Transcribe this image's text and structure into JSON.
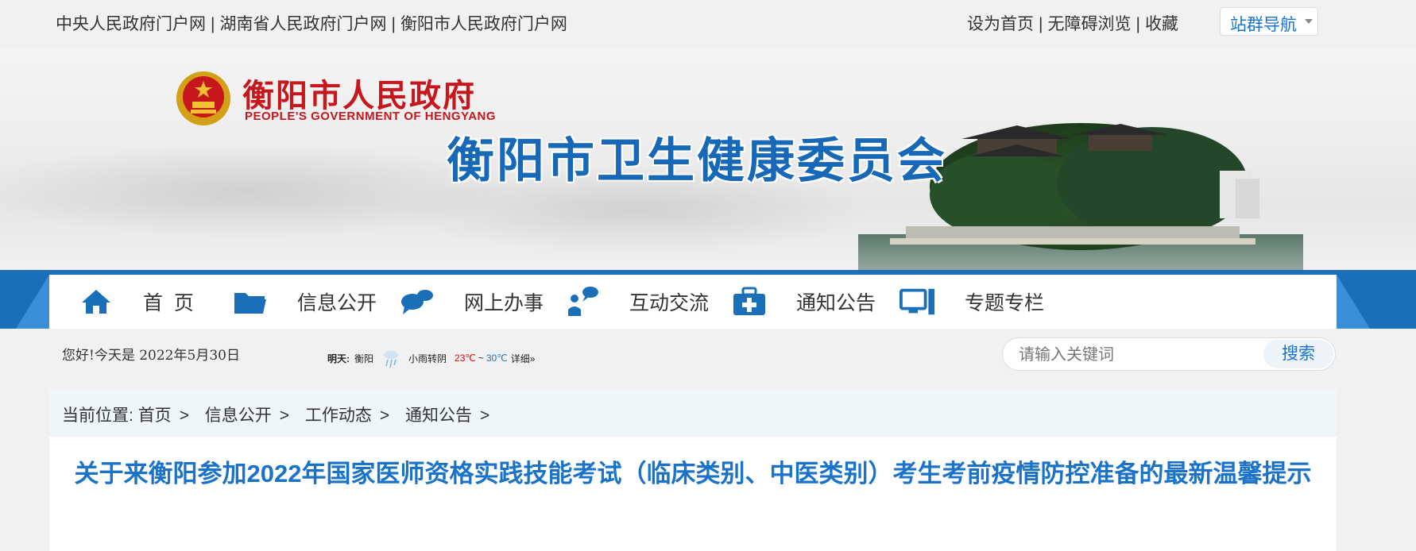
{
  "top_links": [
    "中央人民政府门户网",
    "湖南省人民政府门户网",
    "衡阳市人民政府门户网"
  ],
  "top_right_links": [
    "设为首页",
    "无障碍浏览",
    "收藏"
  ],
  "site_nav_label": "站群导航",
  "banner": {
    "gov_name": "衡阳市人民政府",
    "gov_name_en": "PEOPLE'S GOVERNMENT OF HENGYANG",
    "committee_name": "衡阳市卫生健康委员会"
  },
  "nav": {
    "items": [
      {
        "label": "首  页",
        "icon": "home-icon"
      },
      {
        "label": "信息公开",
        "icon": "folder-icon"
      },
      {
        "label": "网上办事",
        "icon": "chat-icon"
      },
      {
        "label": "互动交流",
        "icon": "user-chat-icon"
      },
      {
        "label": "通知公告",
        "icon": "medical-kit-icon"
      },
      {
        "label": "专题专栏",
        "icon": "monitor-icon"
      }
    ]
  },
  "info": {
    "greeting": "您好!今天是 2022年5月30日",
    "weather_day": "明天:",
    "weather_city": "衡阳",
    "weather_desc": "小雨转阴",
    "temp_high": "23℃",
    "temp_sep": "~",
    "temp_low": "30℃",
    "weather_more": "详细»"
  },
  "search": {
    "placeholder": "请输入关键词",
    "button_label": "搜索"
  },
  "breadcrumb": {
    "label": "当前位置:",
    "items": [
      "首页",
      "信息公开",
      "工作动态",
      "通知公告"
    ]
  },
  "article": {
    "title": "关于来衡阳参加2022年国家医师资格实践技能考试（临床类别、中医类别）考生考前疫情防控准备的最新温馨提示"
  },
  "colors": {
    "brand_blue": "#1a6fb8",
    "title_blue": "#1a73c8",
    "gov_red": "#c8161d"
  }
}
